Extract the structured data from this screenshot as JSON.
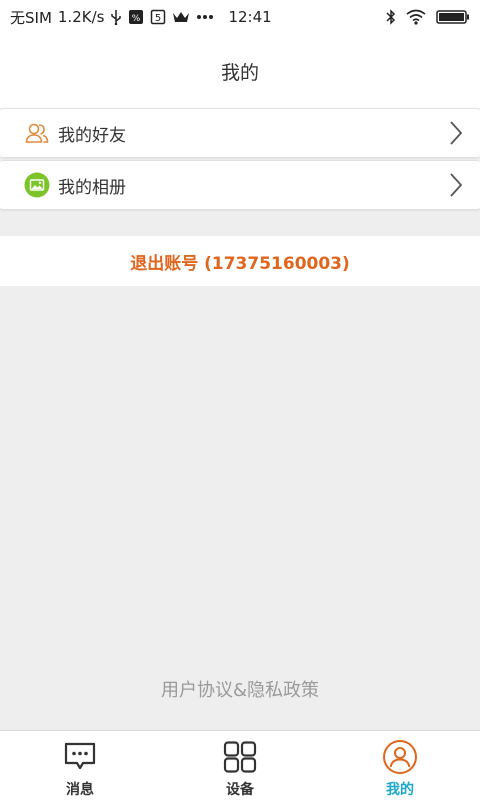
{
  "status_bar": {
    "carrier": "无SIM",
    "speed": "1.2K/s",
    "time": "12:41"
  },
  "header": {
    "title": "我的"
  },
  "menu": {
    "items": [
      {
        "label": "我的好友",
        "icon": "friends-icon"
      },
      {
        "label": "我的相册",
        "icon": "album-icon"
      }
    ]
  },
  "logout": {
    "label": "退出账号 (17375160003)"
  },
  "footer": {
    "policy": "用户协议&隐私政策"
  },
  "tabs": [
    {
      "label": "消息",
      "icon": "message-icon"
    },
    {
      "label": "设备",
      "icon": "device-icon"
    },
    {
      "label": "我的",
      "icon": "profile-icon",
      "active": true
    }
  ],
  "colors": {
    "accent_orange": "#e0661e",
    "active_tab": "#1ba8c9",
    "album_green": "#7cc42a",
    "friends_orange": "#e08a3c"
  }
}
